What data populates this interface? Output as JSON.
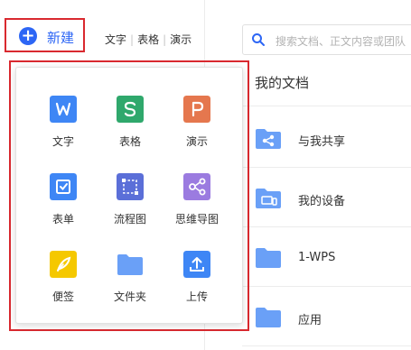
{
  "header": {
    "new_label": "新建",
    "quick_links": [
      "文字",
      "表格",
      "演示"
    ]
  },
  "new_menu": {
    "items": [
      {
        "label": "文字",
        "icon": "writer-doc-icon",
        "color": "#3e86f5"
      },
      {
        "label": "表格",
        "icon": "spreadsheet-icon",
        "color": "#2fa86c"
      },
      {
        "label": "演示",
        "icon": "presentation-icon",
        "color": "#e5774e"
      },
      {
        "label": "表单",
        "icon": "form-icon",
        "color": "#3e86f5"
      },
      {
        "label": "流程图",
        "icon": "flowchart-icon",
        "color": "#5b6fd8"
      },
      {
        "label": "思维导图",
        "icon": "mindmap-icon",
        "color": "#9b7be0"
      },
      {
        "label": "便签",
        "icon": "sticky-note-icon",
        "color": "#f5c800"
      },
      {
        "label": "文件夹",
        "icon": "folder-icon",
        "color": "#6aa0f7"
      },
      {
        "label": "上传",
        "icon": "upload-icon",
        "color": "#3e86f5"
      }
    ]
  },
  "search": {
    "placeholder": "搜索文档、正文内容或团队"
  },
  "main": {
    "title": "我的文档",
    "rows": [
      {
        "label": "与我共享",
        "icon": "shared-folder-icon"
      },
      {
        "label": "我的设备",
        "icon": "device-folder-icon"
      },
      {
        "label": "1-WPS",
        "icon": "folder-icon"
      },
      {
        "label": "应用",
        "icon": "folder-icon"
      }
    ]
  },
  "colors": {
    "accent": "#2d66f5",
    "highlight_border": "#d9292f",
    "folder_blue": "#6aa0f7"
  }
}
